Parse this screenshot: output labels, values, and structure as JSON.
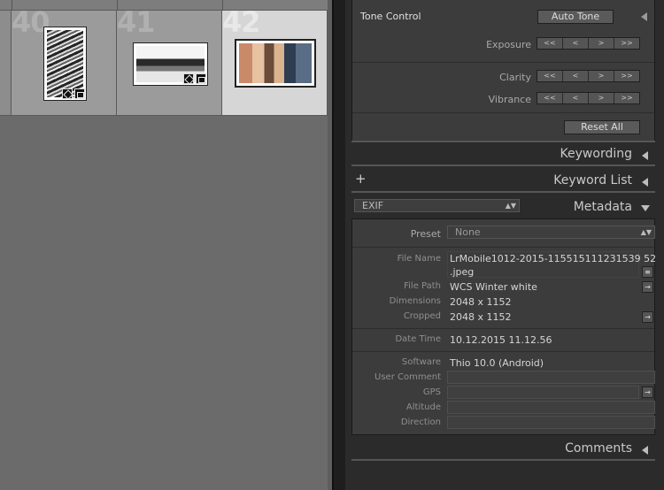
{
  "grid": {
    "cells": [
      {
        "number": "40",
        "selected": false
      },
      {
        "number": "41",
        "selected": false
      },
      {
        "number": "42",
        "selected": true
      }
    ]
  },
  "tone_control": {
    "title": "Tone Control",
    "auto_tone_label": "Auto Tone",
    "exposure_label": "Exposure",
    "clarity_label": "Clarity",
    "vibrance_label": "Vibrance",
    "reset_all_label": "Reset All",
    "step_glyphs": [
      "<<",
      "<",
      ">",
      ">>"
    ]
  },
  "sections": {
    "keywording": "Keywording",
    "keyword_list": "Keyword List",
    "metadata": "Metadata",
    "comments": "Comments"
  },
  "metadata": {
    "view_select": "EXIF",
    "preset_label": "Preset",
    "preset_value": "None",
    "fields": {
      "file_name_label": "File Name",
      "file_name_value_1": "LrMobile1012-2015-115515111231539 52",
      "file_name_value_2": ".jpeg",
      "file_path_label": "File Path",
      "file_path_value": "WCS Winter white",
      "dimensions_label": "Dimensions",
      "dimensions_value": "2048 x 1152",
      "cropped_label": "Cropped",
      "cropped_value": "2048 x 1152",
      "date_time_label": "Date Time",
      "date_time_value": "10.12.2015 11.12.56",
      "software_label": "Software",
      "software_value": "Thio 10.0 (Android)",
      "user_comment_label": "User Comment",
      "gps_label": "GPS",
      "altitude_label": "Altitude",
      "direction_label": "Direction"
    }
  },
  "colors": {
    "panel_bg": "#2b2b2b",
    "box_bg": "#3c3c3c",
    "grid_bg": "#6b6b6b",
    "selected_cell": "#d6d6d6"
  }
}
